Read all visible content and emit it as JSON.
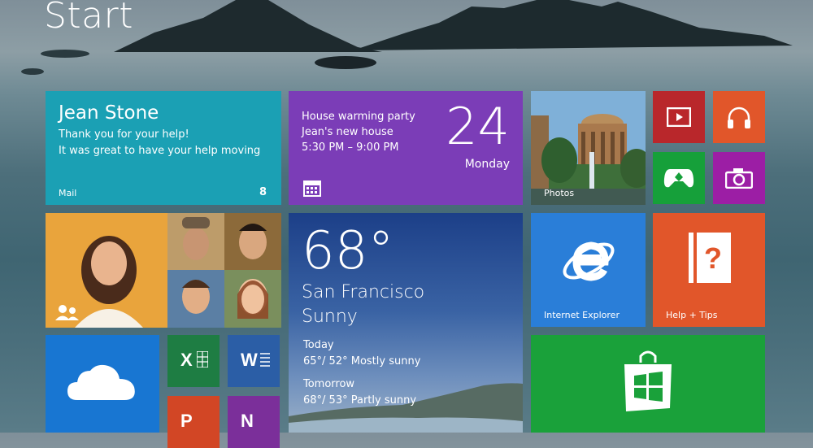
{
  "screen": {
    "title": "Start"
  },
  "tiles": {
    "mail": {
      "sender": "Jean Stone",
      "line1": "Thank you for your help!",
      "line2": "It was great to have your help moving",
      "label": "Mail",
      "count": "8",
      "color": "#1ba0b4"
    },
    "calendar": {
      "event1": "House warming party",
      "event2": "Jean's new house",
      "event3": "5:30 PM – 9:00 PM",
      "day_number": "24",
      "weekday": "Monday",
      "color": "#7b3db7"
    },
    "photos": {
      "label": "Photos"
    },
    "video": {
      "icon": "video-icon",
      "color": "#b9272b"
    },
    "music": {
      "icon": "headphones-icon",
      "color": "#e1562a"
    },
    "games": {
      "icon": "xbox-games-icon",
      "color": "#16a03a"
    },
    "camera": {
      "icon": "camera-icon",
      "color": "#9c1ea5"
    },
    "weather": {
      "temperature": "68°",
      "city": "San Francisco",
      "condition": "Sunny",
      "today_label": "Today",
      "today_forecast": "65°/ 52° Mostly sunny",
      "tomorrow_label": "Tomorrow",
      "tomorrow_forecast": "68°/ 53° Partly sunny"
    },
    "ie": {
      "label": "Internet Explorer",
      "icon": "internet-explorer-icon",
      "color": "#2a7ed8"
    },
    "help": {
      "label": "Help + Tips",
      "icon": "help-book-icon",
      "color": "#e1562a"
    },
    "onedrive": {
      "icon": "cloud-icon",
      "color": "#1876d2"
    },
    "excel": {
      "letter": "X",
      "color": "#1e7d43"
    },
    "word": {
      "letter": "W",
      "color": "#2b5ea6"
    },
    "powerpoint": {
      "letter": "P",
      "color": "#d24625"
    },
    "onenote": {
      "letter": "N",
      "color": "#7b2f9a"
    },
    "store": {
      "icon": "store-bag-icon",
      "color": "#1aa13a"
    }
  }
}
